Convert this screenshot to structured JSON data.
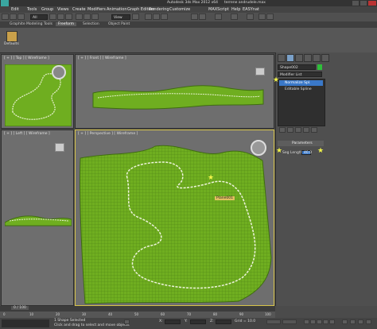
{
  "title_bar": {
    "app_title": "Autodesk 3ds Max 2012 x64",
    "file_name": "terrene andrudele.max"
  },
  "menu": [
    "Edit",
    "Tools",
    "Group",
    "Views",
    "Create",
    "Modifiers",
    "Animation",
    "Graph Editors",
    "Rendering",
    "Customize",
    "MAXScript",
    "Help",
    "EASYnat"
  ],
  "toolbar": {
    "selection_filter": "All",
    "view_dropdown": "View"
  },
  "ribbon_tabs": [
    "Graphite Modeling Tools",
    "Freeform",
    "Selection",
    "Object Paint"
  ],
  "ribbon": {
    "defaults_label": "Defaults"
  },
  "viewports": {
    "top": "[ + ] [ Top ] [ Wireframe ]",
    "front": "[ + ] [ Front ] [ Wireframe ]",
    "left": "[ + ] [ Left ] [ Wireframe ]",
    "perspective": "[ + ] [ Perspective ] [ Wireframe ]",
    "tag_label": "Plane001"
  },
  "command_panel": {
    "object_name": "Shape002",
    "modifier_list_label": "Modifier List",
    "stack_items": [
      "Normalize Spl.",
      "Editable Spline"
    ],
    "rollout_title": "Parameters",
    "param_label": "Seg Length:",
    "param_value": "40.0"
  },
  "timeline": {
    "frame_counter": "0 / 100",
    "ticks": [
      "0",
      "10",
      "20",
      "30",
      "40",
      "50",
      "60",
      "70",
      "80",
      "90",
      "100"
    ]
  },
  "status": {
    "line1": "1 Shape Selected",
    "line2": "Click and drag to select and move objects",
    "x_label": "X:",
    "y_label": "Y:",
    "z_label": "Z:",
    "grid_label": "Grid = 10.0"
  },
  "colors": {
    "terrain": "#6fae20",
    "terrain_dark": "#3f6d10",
    "highlight": "#f2f54a"
  }
}
